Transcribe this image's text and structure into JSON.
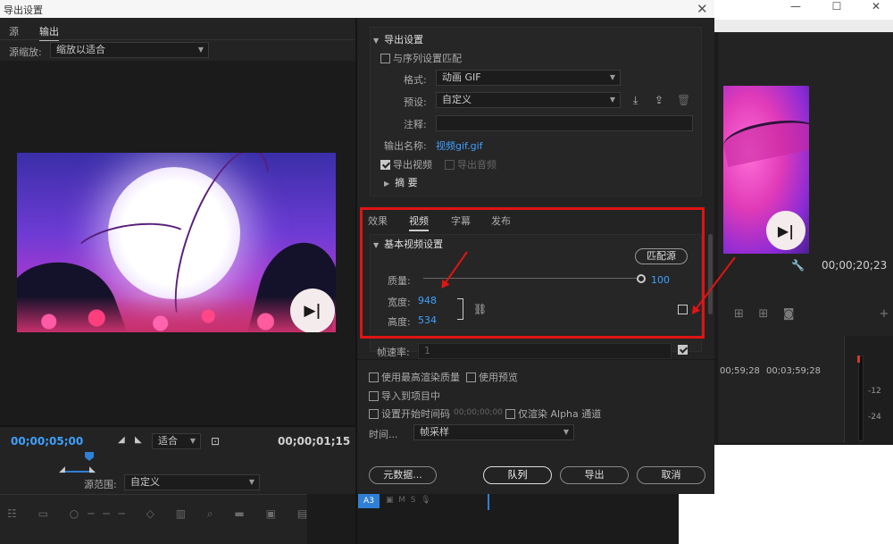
{
  "dialog": {
    "title": "导出设置",
    "close": "✕"
  },
  "left": {
    "tabs": [
      "源",
      "输出"
    ],
    "source_zoom_label": "源缩放:",
    "source_zoom_value": "缩放以适合",
    "timecode_current": "00;00;05;00",
    "fit_value": "适合",
    "timecode_duration": "00;00;01;15",
    "source_range_label": "源范围:",
    "source_range_value": "自定义"
  },
  "export_settings": {
    "section_title": "导出设置",
    "match_sequence_label": "与序列设置匹配",
    "format_label": "格式:",
    "format_value": "动画 GIF",
    "preset_label": "预设:",
    "preset_value": "自定义",
    "comments_label": "注释:",
    "output_name_label": "输出名称:",
    "output_name_value": "视频gif.gif",
    "export_video_label": "导出视频",
    "export_audio_label": "导出音频",
    "summary_label": "摘 要"
  },
  "video_tabs": [
    "效果",
    "视频",
    "字幕",
    "发布"
  ],
  "basic_video": {
    "section_title": "基本视频设置",
    "match_source_label": "匹配源",
    "quality_label": "质量:",
    "quality_value": "100",
    "quality_fraction": 1.0,
    "width_label": "宽度:",
    "width_value": "948",
    "height_label": "高度:",
    "height_value": "534",
    "frame_rate_label": "帧速率:",
    "frame_rate_value": "1"
  },
  "options": {
    "max_render_quality": "使用最高渲染质量",
    "use_previews": "使用预览",
    "import_to_project": "导入到项目中",
    "set_start_timecode": "设置开始时间码",
    "start_timecode_value": "00;00;00;00",
    "render_alpha_only": "仅渲染 Alpha 通道",
    "time_interp_label": "时间...",
    "time_interp_value": "帧采样"
  },
  "buttons": {
    "metadata": "元数据...",
    "queue": "队列",
    "export": "导出",
    "cancel": "取消"
  },
  "background": {
    "timecode": "00;00;20;23",
    "ts_a": "00;59;28",
    "ts_b": "00;03;59;28",
    "meter_labels": [
      "-12",
      "-24"
    ],
    "track_label": "A3"
  },
  "colors": {
    "accent_blue": "#3ea0ff",
    "annotation_red": "#e01414",
    "panel_bg": "#232323"
  }
}
